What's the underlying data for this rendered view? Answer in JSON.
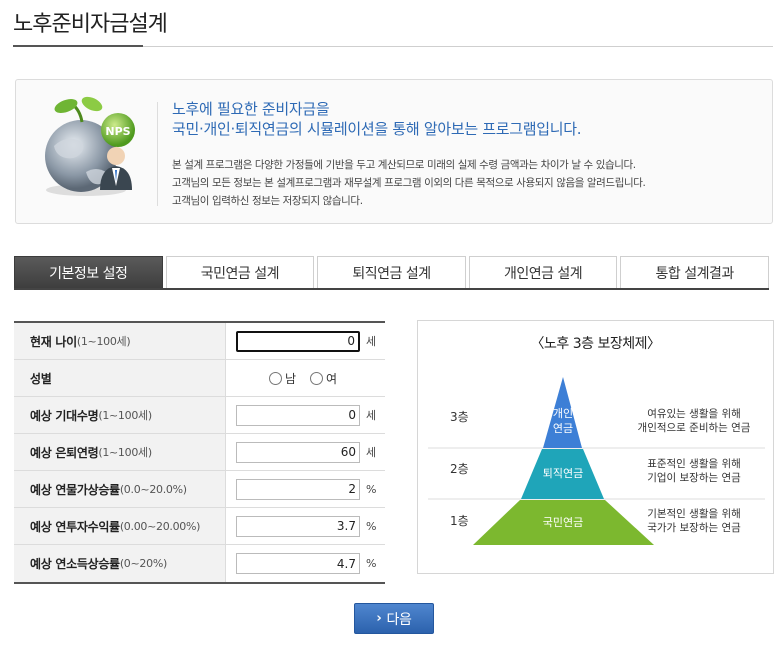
{
  "page": {
    "title": "노후준비자금설계"
  },
  "intro": {
    "headline_line1": "노후에 필요한 준비자금을",
    "headline_line2": "국민·개인·퇴직연금의 시뮬레이션을 통해 알아보는 프로그램입니다.",
    "desc_line1": "본 설계 프로그램은 다양한 가정들에 기반을 두고 계산되므로 미래의 실제 수령 금액과는 차이가 날 수 있습니다.",
    "desc_line2": "고객님의 모든 정보는 본 설계프로그램과 재무설계 프로그램 이외의 다른 목적으로 사용되지 않음을 알려드립니다.",
    "desc_line3": "고객님이 입력하신 정보는 저장되지 않습니다.",
    "badge": "NPS"
  },
  "tabs": [
    {
      "label": "기본정보 설정",
      "active": true
    },
    {
      "label": "국민연금 설계",
      "active": false
    },
    {
      "label": "퇴직연금 설계",
      "active": false
    },
    {
      "label": "개인연금 설계",
      "active": false
    },
    {
      "label": "통합 설계결과",
      "active": false
    }
  ],
  "form": {
    "age": {
      "label": "현재 나이",
      "range": "(1~100세)",
      "value": "0",
      "unit": "세"
    },
    "gender": {
      "label": "성별",
      "opt_male": "남",
      "opt_female": "여"
    },
    "life_expectancy": {
      "label": "예상 기대수명",
      "range": "(1~100세)",
      "value": "0",
      "unit": "세"
    },
    "retire_age": {
      "label": "예상 은퇴연령",
      "range": "(1~100세)",
      "value": "60",
      "unit": "세"
    },
    "inflation": {
      "label": "예상 연물가상승률",
      "range": "(0.0~20.0%)",
      "value": "2",
      "unit": "%"
    },
    "investment": {
      "label": "예상 연투자수익률",
      "range": "(0.00~20.00%)",
      "value": "3.7",
      "unit": "%"
    },
    "income_growth": {
      "label": "예상 연소득상승률",
      "range": "(0~20%)",
      "value": "4.7",
      "unit": "%"
    }
  },
  "pyramid": {
    "title": "〈노후 3층 보장체제〉",
    "tiers": [
      {
        "level": "3층",
        "name_line1": "개인",
        "name_line2": "연금",
        "desc_line1": "여유있는 생활을 위해",
        "desc_line2": "개인적으로 준비하는 연금",
        "color": "#3d7fd6"
      },
      {
        "level": "2층",
        "name_line1": "퇴직연금",
        "name_line2": "",
        "desc_line1": "표준적인 생활을 위해",
        "desc_line2": "기업이 보장하는 연금",
        "color": "#1fa5b9"
      },
      {
        "level": "1층",
        "name_line1": "국민연금",
        "name_line2": "",
        "desc_line1": "기본적인 생활을 위해",
        "desc_line2": "국가가 보장하는 연금",
        "color": "#7cb82f"
      }
    ]
  },
  "next_button": {
    "label": "다음"
  }
}
